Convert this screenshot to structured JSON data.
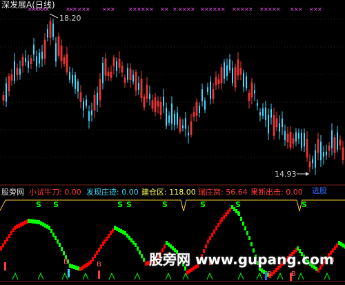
{
  "app": {
    "title": "深发展A(日线)",
    "panel_name": "股旁网"
  },
  "price_chart": {
    "high_label": "18.20",
    "low_label": "14.93"
  },
  "indicator_bar": {
    "items": [
      {
        "label": "小试牛刀:",
        "value": "0.00",
        "color": "#ff3b3b"
      },
      {
        "label": "发现庄迹:",
        "value": "0.00",
        "color": "#3fd8ff"
      },
      {
        "label": "建仓区:",
        "value": "118.00",
        "color": "#ffff55"
      },
      {
        "label": "瑞庄窝:",
        "value": "56.64",
        "color": "#ff3b3b"
      },
      {
        "label": "果断出击:",
        "value": "0.00",
        "color": "#ff3b3b"
      }
    ],
    "select_label": "选股"
  },
  "marks": {
    "s_label": "S",
    "b_label": "B",
    "x_label": "×"
  },
  "watermark": "股旁网 www.gupang.com",
  "colors": {
    "up": "#ff3b3b",
    "down": "#3fd8ff",
    "rise": "#ff0000",
    "fall": "#00ff00",
    "magenta": "#ff55ff",
    "s_green": "#00ff00",
    "gold": "#ffcc33"
  }
}
